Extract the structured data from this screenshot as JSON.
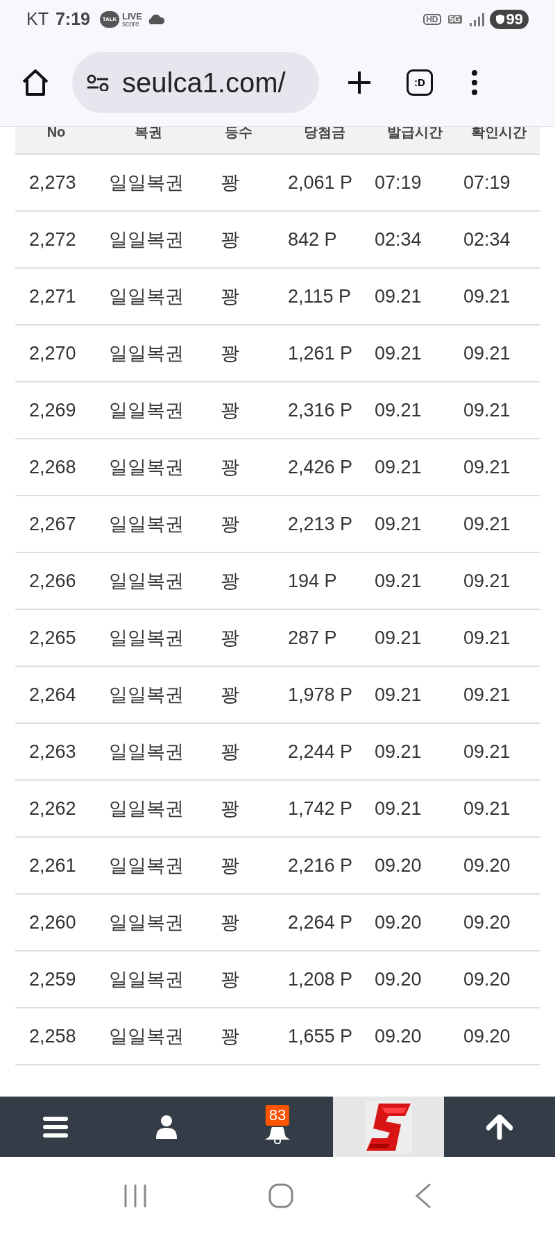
{
  "status_bar": {
    "carrier": "KT",
    "time": "7:19",
    "talk_label": "TALK",
    "live_label": "LIVE",
    "score_label": "score",
    "hd_label": "HD",
    "network": "5G",
    "battery": "99"
  },
  "browser": {
    "url": "seulca1.com/",
    "tab_label": ":D"
  },
  "table": {
    "columns": [
      "No",
      "복권",
      "등수",
      "당첨금",
      "발급시간",
      "확인시간"
    ],
    "rows": [
      [
        "2,273",
        "일일복권",
        "꽝",
        "2,061 P",
        "07:19",
        "07:19"
      ],
      [
        "2,272",
        "일일복권",
        "꽝",
        "842 P",
        "02:34",
        "02:34"
      ],
      [
        "2,271",
        "일일복권",
        "꽝",
        "2,115 P",
        "09.21",
        "09.21"
      ],
      [
        "2,270",
        "일일복권",
        "꽝",
        "1,261 P",
        "09.21",
        "09.21"
      ],
      [
        "2,269",
        "일일복권",
        "꽝",
        "2,316 P",
        "09.21",
        "09.21"
      ],
      [
        "2,268",
        "일일복권",
        "꽝",
        "2,426 P",
        "09.21",
        "09.21"
      ],
      [
        "2,267",
        "일일복권",
        "꽝",
        "2,213 P",
        "09.21",
        "09.21"
      ],
      [
        "2,266",
        "일일복권",
        "꽝",
        "194 P",
        "09.21",
        "09.21"
      ],
      [
        "2,265",
        "일일복권",
        "꽝",
        "287 P",
        "09.21",
        "09.21"
      ],
      [
        "2,264",
        "일일복권",
        "꽝",
        "1,978 P",
        "09.21",
        "09.21"
      ],
      [
        "2,263",
        "일일복권",
        "꽝",
        "2,244 P",
        "09.21",
        "09.21"
      ],
      [
        "2,262",
        "일일복권",
        "꽝",
        "1,742 P",
        "09.21",
        "09.21"
      ],
      [
        "2,261",
        "일일복권",
        "꽝",
        "2,216 P",
        "09.20",
        "09.20"
      ],
      [
        "2,260",
        "일일복권",
        "꽝",
        "2,264 P",
        "09.20",
        "09.20"
      ],
      [
        "2,259",
        "일일복권",
        "꽝",
        "1,208 P",
        "09.20",
        "09.20"
      ],
      [
        "2,258",
        "일일복권",
        "꽝",
        "1,655 P",
        "09.20",
        "09.20"
      ]
    ]
  },
  "bottom_nav": {
    "notification_count": "83"
  }
}
